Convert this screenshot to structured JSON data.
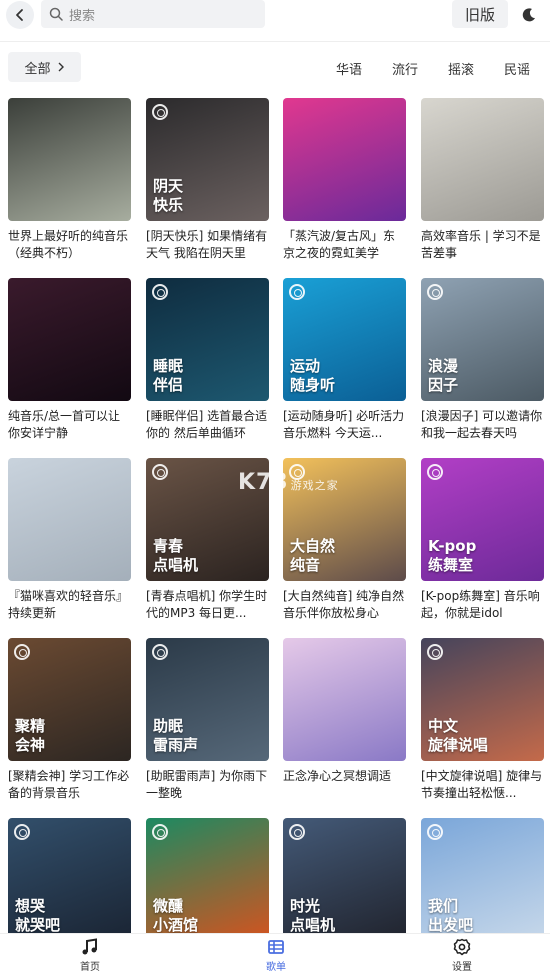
{
  "topbar": {
    "search_placeholder": "搜索",
    "old_label": "旧版"
  },
  "filters": {
    "all_label": "全部",
    "genres": [
      "华语",
      "流行",
      "摇滚",
      "民谣"
    ]
  },
  "playlists": [
    {
      "cover_text": "",
      "caption": "世界上最好听的纯音乐（经典不朽）",
      "colors": [
        "#3b3f3a",
        "#a7ad9f"
      ],
      "badge": false
    },
    {
      "cover_text": "阴天\n快乐",
      "caption": "[阴天快乐] 如果情绪有天气 我陷在阴天里",
      "colors": [
        "#2b2a2c",
        "#6b6160"
      ],
      "badge": true
    },
    {
      "cover_text": "",
      "caption": "「蒸汽波/复古风」东京之夜的霓虹美学",
      "colors": [
        "#e1388f",
        "#6a2a9a"
      ],
      "badge": false
    },
    {
      "cover_text": "",
      "caption": "高效率音乐 | 学习不是苦差事",
      "colors": [
        "#d8d6cf",
        "#9c9a94"
      ],
      "badge": false
    },
    {
      "cover_text": "",
      "caption": "纯音乐/总一首可以让你安详宁静",
      "colors": [
        "#3a1a2c",
        "#120912"
      ],
      "badge": false
    },
    {
      "cover_text": "睡眠\n伴侣",
      "caption": "[睡眠伴侣] 选首最合适你的 然后单曲循环",
      "colors": [
        "#0f2c3f",
        "#1d5870"
      ],
      "badge": true
    },
    {
      "cover_text": "运动\n随身听",
      "caption": "[运动随身听] 必听活力音乐燃料 今天运...",
      "colors": [
        "#1aa0d6",
        "#0b5f95"
      ],
      "badge": true
    },
    {
      "cover_text": "浪漫\n因子",
      "caption": "[浪漫因子] 可以邀请你和我一起去春天吗",
      "colors": [
        "#8fa2b3",
        "#4c5a64"
      ],
      "badge": true
    },
    {
      "cover_text": "",
      "caption": "『猫咪喜欢的轻音乐』持续更新",
      "colors": [
        "#c9d3dd",
        "#a4afba"
      ],
      "badge": false
    },
    {
      "cover_text": "青春\n点唱机",
      "caption": "[青春点唱机] 你学生时代的MP3 每日更...",
      "colors": [
        "#6a5446",
        "#2b2320"
      ],
      "badge": true
    },
    {
      "cover_text": "大自然\n纯音",
      "caption": "[大自然纯音] 纯净自然音乐伴你放松身心",
      "colors": [
        "#f3c15b",
        "#5d4b4a"
      ],
      "badge": true
    },
    {
      "cover_text": "K-pop\n练舞室",
      "caption": "[K-pop练舞室] 音乐响起，你就是idol",
      "colors": [
        "#b23fc6",
        "#6d2a99"
      ],
      "badge": true
    },
    {
      "cover_text": "聚精\n会神",
      "caption": "[聚精会神] 学习工作必备的背景音乐",
      "colors": [
        "#6b4a32",
        "#2c2622"
      ],
      "badge": true
    },
    {
      "cover_text": "助眠\n雷雨声",
      "caption": "[助眠雷雨声] 为你雨下一整晚",
      "colors": [
        "#2b3a48",
        "#566879"
      ],
      "badge": true
    },
    {
      "cover_text": "",
      "caption": "正念净心之冥想调适",
      "colors": [
        "#e5c9e8",
        "#8a79c6"
      ],
      "badge": false
    },
    {
      "cover_text": "中文\n旋律说唱",
      "caption": "[中文旋律说唱] 旋律与节奏撞出轻松惬...",
      "colors": [
        "#45445c",
        "#c46a4a"
      ],
      "badge": true
    },
    {
      "cover_text": "想哭\n就哭吧",
      "caption": "",
      "colors": [
        "#324f6b",
        "#1a2433"
      ],
      "badge": true
    },
    {
      "cover_text": "微醺\n小酒馆",
      "caption": "",
      "colors": [
        "#1c8a62",
        "#d4531f"
      ],
      "badge": true
    },
    {
      "cover_text": "时光\n点唱机",
      "caption": "",
      "colors": [
        "#445a78",
        "#20232d"
      ],
      "badge": true
    },
    {
      "cover_text": "我们\n出发吧",
      "caption": "",
      "colors": [
        "#7aa6d9",
        "#c7d8ea"
      ],
      "badge": true
    }
  ],
  "watermark": {
    "main": "K73",
    "sub": "游戏之家"
  },
  "bottomnav": {
    "items": [
      {
        "label": "首页",
        "icon": "music-note-icon"
      },
      {
        "label": "歌单",
        "icon": "playlist-icon"
      },
      {
        "label": "设置",
        "icon": "gear-icon"
      }
    ],
    "active_color": "#4a6ee0"
  }
}
